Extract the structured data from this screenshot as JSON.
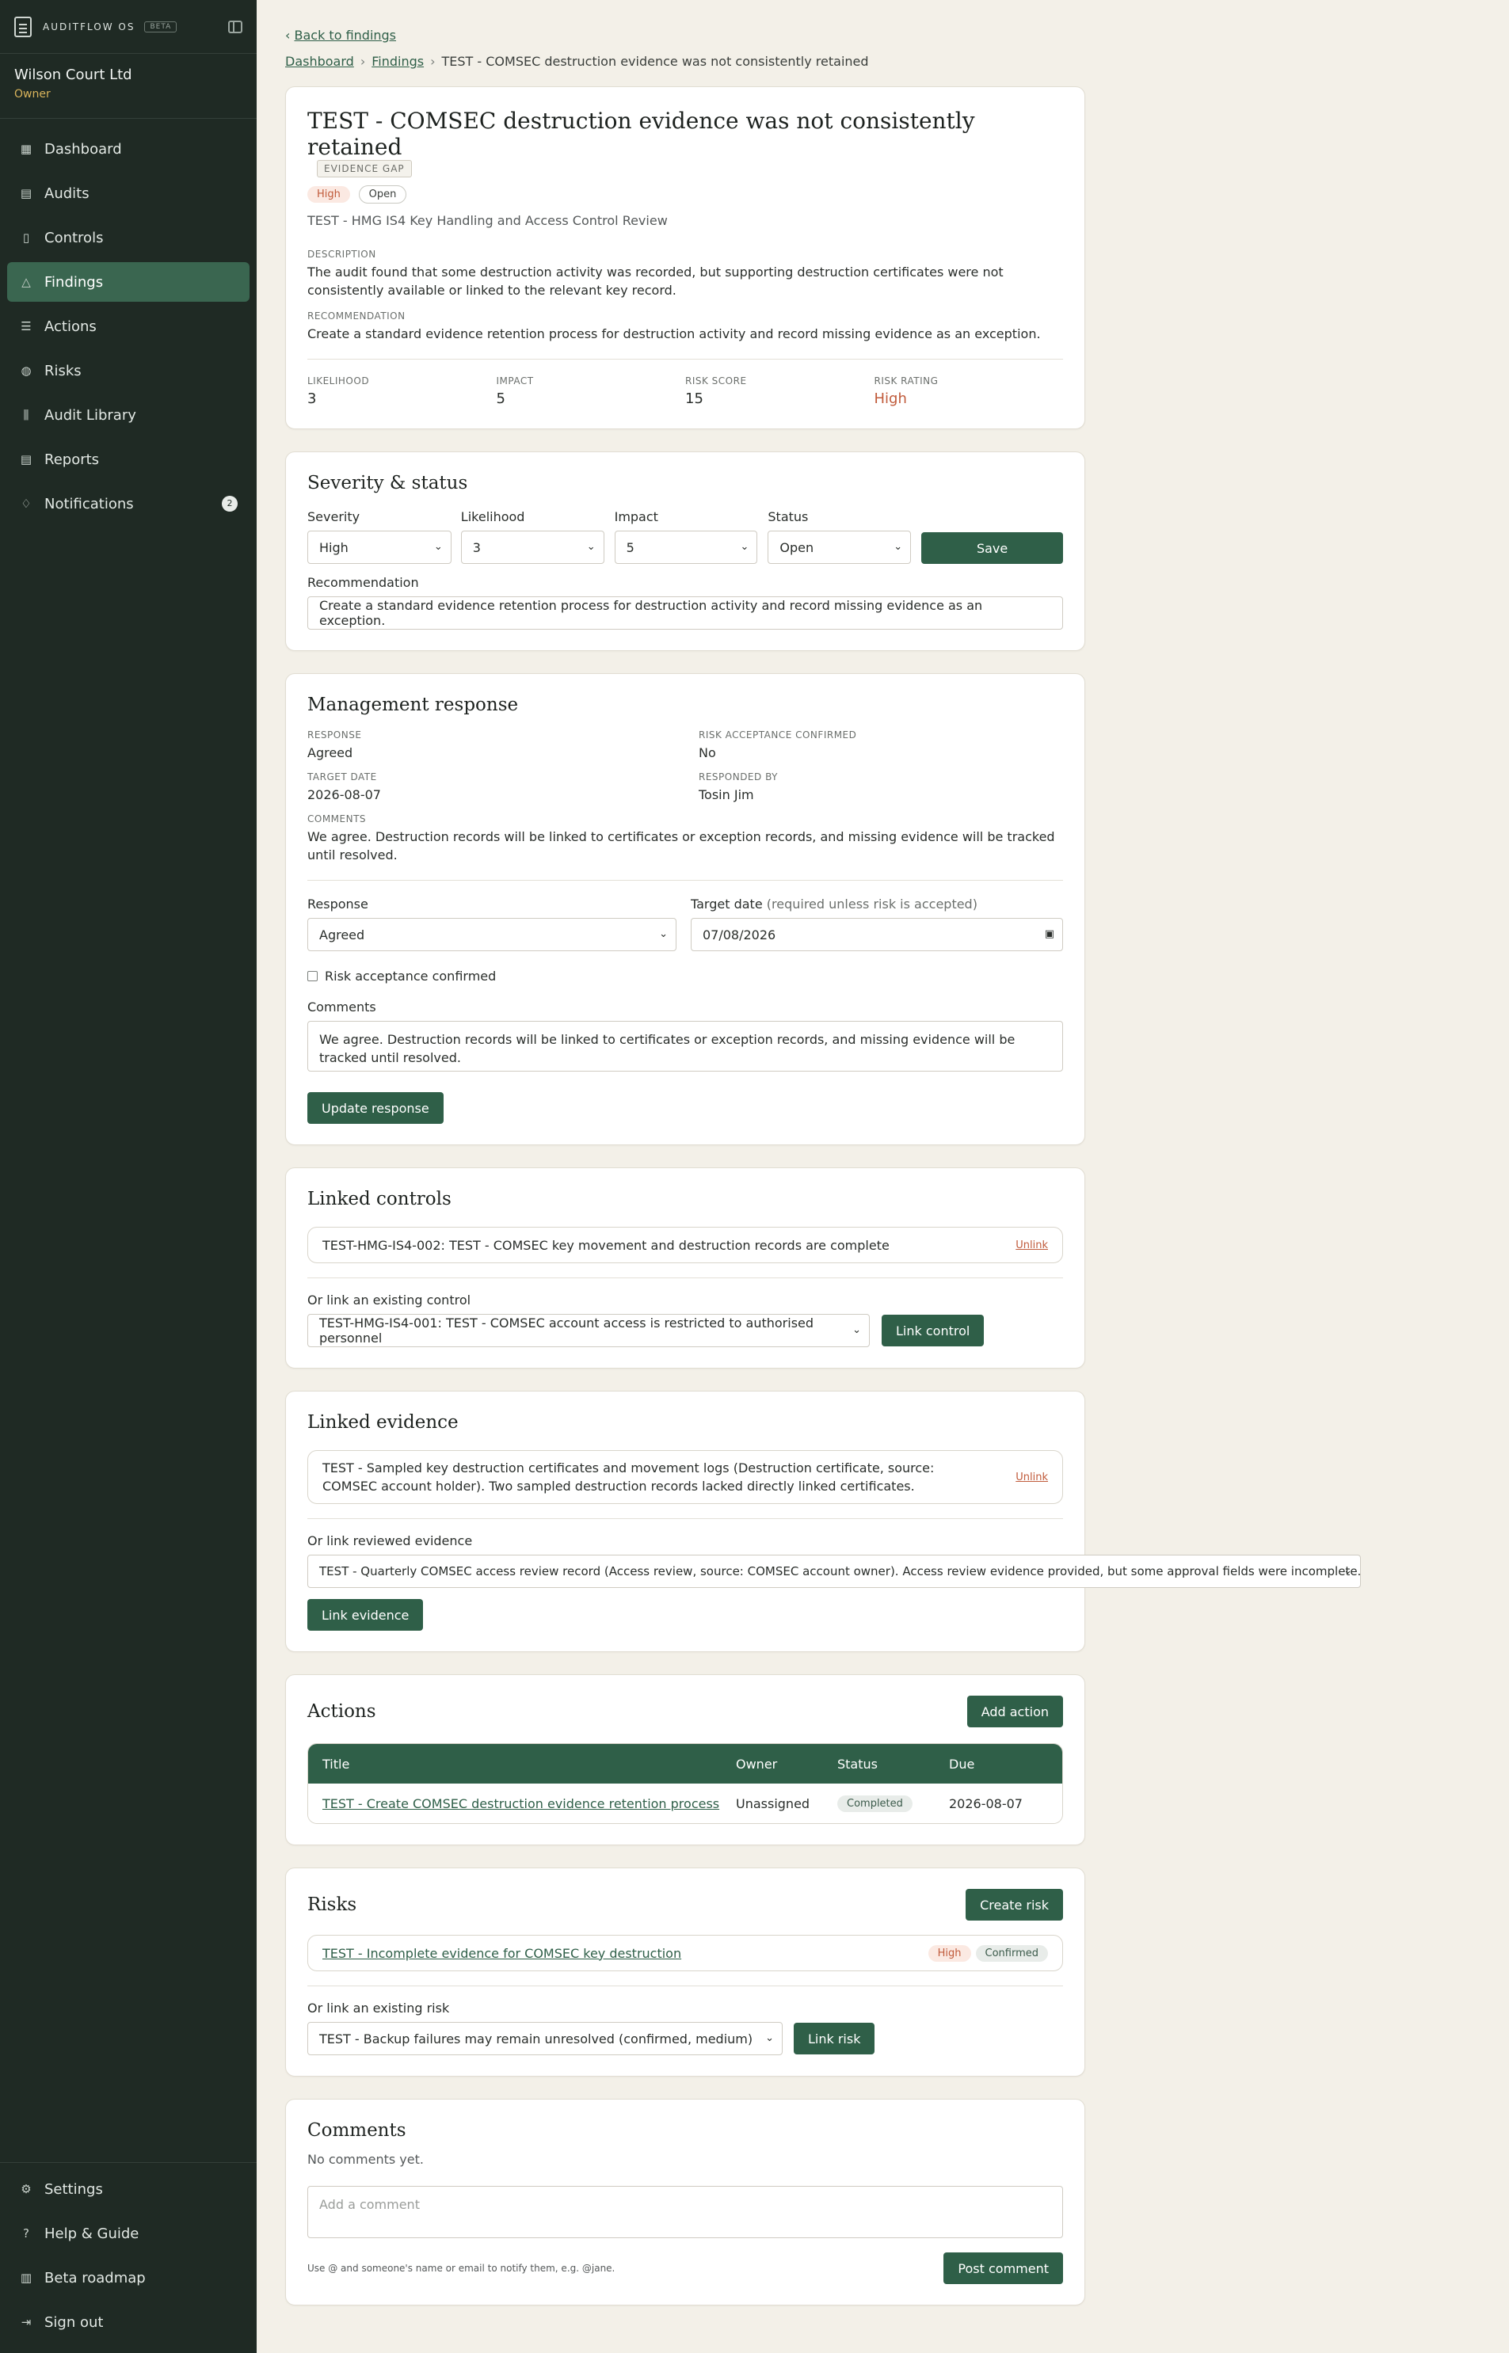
{
  "brand": {
    "name": "AUDITFLOW OS",
    "beta": "BETA"
  },
  "org": {
    "name": "Wilson Court Ltd",
    "role": "Owner"
  },
  "nav": [
    {
      "label": "Dashboard",
      "icon": "dashboard-icon"
    },
    {
      "label": "Audits",
      "icon": "clipboard-icon"
    },
    {
      "label": "Controls",
      "icon": "book-icon"
    },
    {
      "label": "Findings",
      "icon": "warning-icon",
      "active": true
    },
    {
      "label": "Actions",
      "icon": "checklist-icon"
    },
    {
      "label": "Risks",
      "icon": "shield-icon"
    },
    {
      "label": "Audit Library",
      "icon": "library-icon"
    },
    {
      "label": "Reports",
      "icon": "report-icon"
    },
    {
      "label": "Notifications",
      "icon": "bell-icon",
      "badge": "2"
    }
  ],
  "nav_bottom": [
    {
      "label": "Settings",
      "icon": "gear-icon"
    },
    {
      "label": "Help & Guide",
      "icon": "help-icon"
    },
    {
      "label": "Beta roadmap",
      "icon": "map-icon"
    },
    {
      "label": "Sign out",
      "icon": "sign-out-icon"
    }
  ],
  "back": "Back to findings",
  "breadcrumb": {
    "dashboard": "Dashboard",
    "findings": "Findings",
    "current": "TEST - COMSEC destruction evidence was not consistently retained"
  },
  "finding": {
    "title": "TEST - COMSEC destruction evidence was not consistently retained",
    "tag": "EVIDENCE GAP",
    "severity": "High",
    "status": "Open",
    "audit": "TEST - HMG IS4 Key Handling and Access Control Review",
    "description_label": "DESCRIPTION",
    "description": "The audit found that some destruction activity was recorded, but supporting destruction certificates were not consistently available or linked to the relevant key record.",
    "recommendation_label": "RECOMMENDATION",
    "recommendation": "Create a standard evidence retention process for destruction activity and record missing evidence as an exception.",
    "likelihood_label": "LIKELIHOOD",
    "likelihood": "3",
    "impact_label": "IMPACT",
    "impact": "5",
    "score_label": "RISK SCORE",
    "score": "15",
    "rating_label": "RISK RATING",
    "rating": "High"
  },
  "severity_status": {
    "title": "Severity & status",
    "severity_label": "Severity",
    "severity": "High",
    "likelihood_label": "Likelihood",
    "likelihood": "3",
    "impact_label": "Impact",
    "impact": "5",
    "status_label": "Status",
    "status": "Open",
    "save": "Save",
    "recommendation_label": "Recommendation",
    "recommendation": "Create a standard evidence retention process for destruction activity and record missing evidence as an exception."
  },
  "management": {
    "title": "Management response",
    "response_label": "RESPONSE",
    "response": "Agreed",
    "risk_label": "RISK ACCEPTANCE CONFIRMED",
    "risk": "No",
    "target_label": "TARGET DATE",
    "target": "2026-08-07",
    "by_label": "RESPONDED BY",
    "by": "Tosin Jim",
    "comments_label": "COMMENTS",
    "comments": "We agree. Destruction records will be linked to certificates or exception records, and missing evidence will be tracked until resolved.",
    "form_response_label": "Response",
    "form_response": "Agreed",
    "form_target_label": "Target date",
    "form_target_hint": "(required unless risk is accepted)",
    "form_target": "07/08/2026",
    "checkbox_label": "Risk acceptance confirmed",
    "form_comments_label": "Comments",
    "form_comments": "We agree. Destruction records will be linked to certificates or exception records, and missing evidence will be tracked until resolved.",
    "update": "Update response"
  },
  "controls": {
    "title": "Linked controls",
    "linked": "TEST-HMG-IS4-002: TEST - COMSEC key movement and destruction records are complete",
    "unlink": "Unlink",
    "link_label": "Or link an existing control",
    "select": "TEST-HMG-IS4-001: TEST - COMSEC account access is restricted to authorised personnel",
    "button": "Link control"
  },
  "evidence": {
    "title": "Linked evidence",
    "linked": "TEST - Sampled key destruction certificates and movement logs (Destruction certificate, source: COMSEC account holder). Two sampled destruction records lacked directly linked certificates.",
    "unlink": "Unlink",
    "link_label": "Or link reviewed evidence",
    "select": "TEST - Quarterly COMSEC access review record (Access review, source: COMSEC account owner). Access review evidence provided, but some approval fields were incomplete.",
    "button": "Link evidence"
  },
  "actions": {
    "title": "Actions",
    "add": "Add action",
    "columns": [
      "Title",
      "Owner",
      "Status",
      "Due"
    ],
    "rows": [
      {
        "title": "TEST - Create COMSEC destruction evidence retention process",
        "owner": "Unassigned",
        "status": "Completed",
        "due": "2026-08-07"
      }
    ]
  },
  "risks": {
    "title": "Risks",
    "create": "Create risk",
    "linked": "TEST - Incomplete evidence for COMSEC key destruction",
    "linked_rating": "High",
    "linked_status": "Confirmed",
    "link_label": "Or link an existing risk",
    "select": "TEST - Backup failures may remain unresolved (confirmed, medium)",
    "button": "Link risk"
  },
  "comments": {
    "title": "Comments",
    "empty": "No comments yet.",
    "placeholder": "Add a comment",
    "hint": "Use @ and someone's name or email to notify them, e.g. @jane.",
    "post": "Post comment"
  }
}
